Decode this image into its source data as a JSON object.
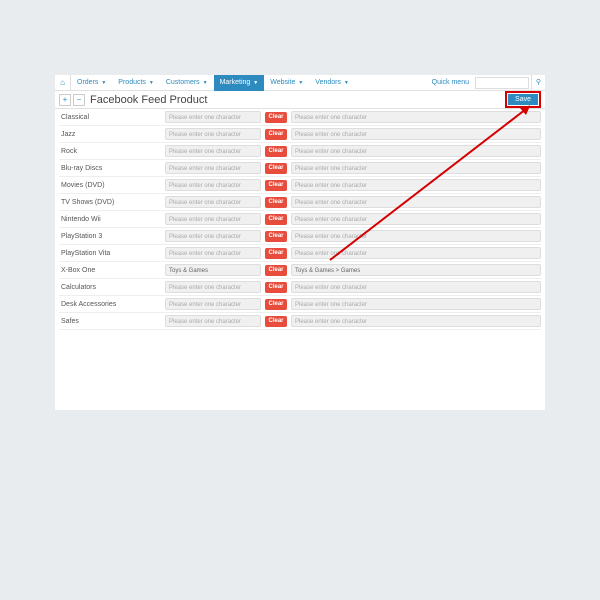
{
  "nav": {
    "items": [
      "Orders",
      "Products",
      "Customers",
      "Marketing",
      "Website",
      "Vendors"
    ],
    "active": 3,
    "quick": "Quick menu"
  },
  "page": {
    "title": "Facebook Feed Product",
    "save": "Save"
  },
  "placeholder": "Please enter one character",
  "clear": "Clear",
  "rows": [
    {
      "label": "Classical",
      "v1": "",
      "v2": ""
    },
    {
      "label": "Jazz",
      "v1": "",
      "v2": ""
    },
    {
      "label": "Rock",
      "v1": "",
      "v2": ""
    },
    {
      "label": "Blu-ray Discs",
      "v1": "",
      "v2": ""
    },
    {
      "label": "Movies (DVD)",
      "v1": "",
      "v2": ""
    },
    {
      "label": "TV Shows (DVD)",
      "v1": "",
      "v2": ""
    },
    {
      "label": "Nintendo Wii",
      "v1": "",
      "v2": ""
    },
    {
      "label": "PlayStation 3",
      "v1": "",
      "v2": ""
    },
    {
      "label": "PlayStation Vita",
      "v1": "",
      "v2": ""
    },
    {
      "label": "X-Box One",
      "v1": "Toys & Games",
      "v2": "Toys & Games > Games"
    },
    {
      "label": "Calculators",
      "v1": "",
      "v2": ""
    },
    {
      "label": "Desk Accessories",
      "v1": "",
      "v2": ""
    },
    {
      "label": "Safes",
      "v1": "",
      "v2": ""
    }
  ]
}
